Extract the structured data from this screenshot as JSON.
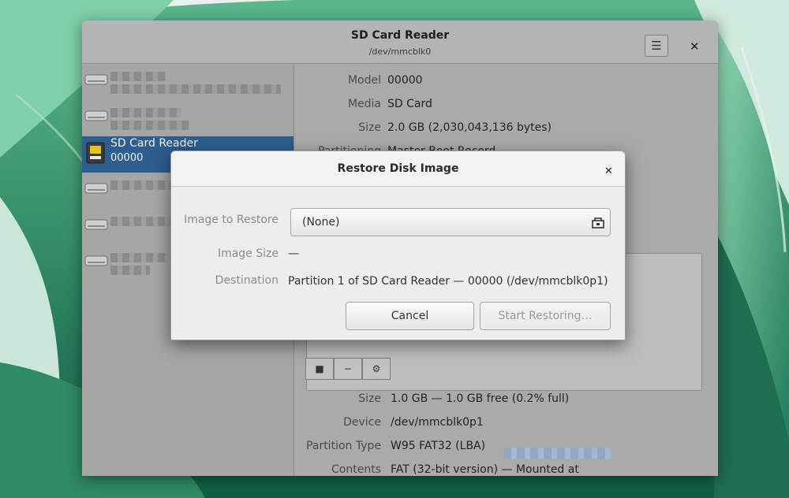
{
  "window": {
    "title": "SD Card Reader",
    "subtitle": "/dev/mmcblk0",
    "menu_icon": "hamburger-menu-icon",
    "close_label": "✕"
  },
  "sidebar": {
    "items": [
      {
        "name": "",
        "sub": "",
        "icon": "drive-icon"
      },
      {
        "name": "",
        "sub": "",
        "icon": "drive-icon"
      },
      {
        "name": "SD Card Reader",
        "sub": "00000",
        "icon": "sd-card-icon",
        "selected": true
      },
      {
        "name": "",
        "sub": "",
        "icon": "drive-icon"
      },
      {
        "name": "",
        "sub": "",
        "icon": "drive-icon"
      },
      {
        "name": "",
        "sub": "",
        "icon": "drive-icon"
      }
    ]
  },
  "drive_info": {
    "model_label": "Model",
    "model_value": "00000",
    "media_label": "Media",
    "media_value": "SD Card",
    "size_label": "Size",
    "size_value": "2.0 GB (2,030,043,136 bytes)",
    "partitioning_label": "Partitioning",
    "partitioning_value": "Master Boot Record"
  },
  "volume_info": {
    "size_label": "Size",
    "size_value": "1.0 GB — 1.0 GB free (0.2% full)",
    "device_label": "Device",
    "device_value": "/dev/mmcblk0p1",
    "partition_type_label": "Partition Type",
    "partition_type_value": "W95 FAT32 (LBA)",
    "contents_label": "Contents",
    "contents_value": "FAT (32-bit version) — Mounted at"
  },
  "dialog": {
    "title": "Restore Disk Image",
    "close_label": "✕",
    "image_label": "Image to Restore",
    "image_value": "(None)",
    "image_size_label": "Image Size",
    "image_size_value": "—",
    "destination_label": "Destination",
    "destination_value": "Partition 1 of SD Card Reader — 00000 (/dev/mmcblk0p1)",
    "cancel_label": "Cancel",
    "start_label": "Start Restoring…"
  },
  "colors": {
    "selection": "#2d5e8f",
    "dialog_bg": "#ededed",
    "dim_window": "#a9a9a9"
  }
}
